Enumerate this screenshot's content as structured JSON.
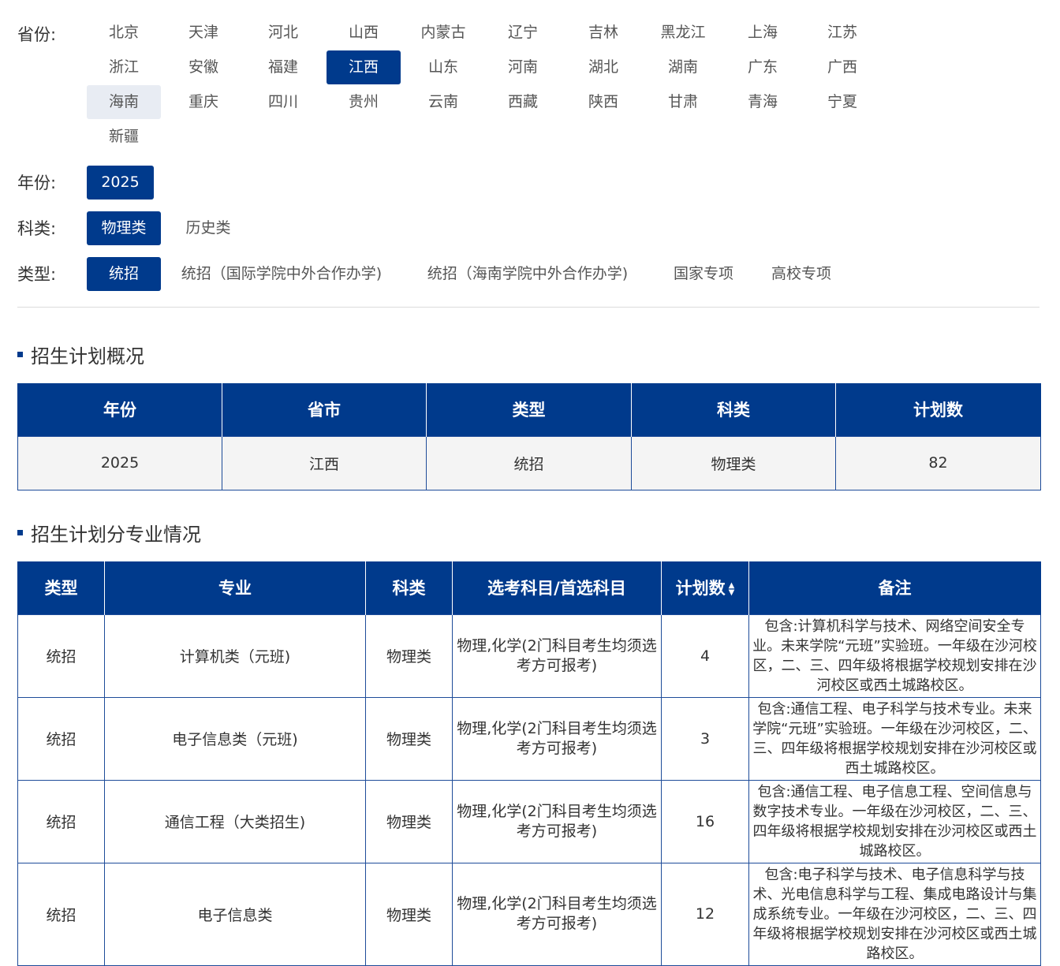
{
  "filters": {
    "province": {
      "label": "省份:",
      "options": [
        "北京",
        "天津",
        "河北",
        "山西",
        "内蒙古",
        "辽宁",
        "吉林",
        "黑龙江",
        "上海",
        "江苏",
        "浙江",
        "安徽",
        "福建",
        "江西",
        "山东",
        "河南",
        "湖北",
        "湖南",
        "广东",
        "广西",
        "海南",
        "重庆",
        "四川",
        "贵州",
        "云南",
        "西藏",
        "陕西",
        "甘肃",
        "青海",
        "宁夏",
        "新疆"
      ],
      "selected": "江西"
    },
    "year": {
      "label": "年份:",
      "options": [
        "2025"
      ],
      "selected": "2025"
    },
    "subject": {
      "label": "科类:",
      "options": [
        "物理类",
        "历史类"
      ],
      "selected": "物理类"
    },
    "type": {
      "label": "类型:",
      "options": [
        "统招",
        "统招（国际学院中外合作办学)",
        "统招（海南学院中外合作办学)",
        "国家专项",
        "高校专项"
      ],
      "selected": "统招"
    }
  },
  "colors": {
    "primary": "#003a8c",
    "hover": "#e8ecf3"
  },
  "summary": {
    "title": "招生计划概况",
    "headers": [
      "年份",
      "省市",
      "类型",
      "科类",
      "计划数"
    ],
    "row": [
      "2025",
      "江西",
      "统招",
      "物理类",
      "82"
    ]
  },
  "majors": {
    "title": "招生计划分专业情况",
    "headers": [
      "类型",
      "专业",
      "科类",
      "选考科目/首选科目",
      "计划数",
      "备注"
    ],
    "sort_icon": "sort-icon",
    "rows": [
      [
        "统招",
        "计算机类（元班)",
        "物理类",
        "物理,化学(2门科目考生均须选考方可报考)",
        "4",
        "包含:计算机科学与技术、网络空间安全专业。未来学院“元班”实验班。一年级在沙河校区，二、三、四年级将根据学校规划安排在沙河校区或西土城路校区。"
      ],
      [
        "统招",
        "电子信息类（元班)",
        "物理类",
        "物理,化学(2门科目考生均须选考方可报考)",
        "3",
        "包含:通信工程、电子科学与技术专业。未来学院“元班”实验班。一年级在沙河校区，二、三、四年级将根据学校规划安排在沙河校区或西土城路校区。"
      ],
      [
        "统招",
        "通信工程（大类招生)",
        "物理类",
        "物理,化学(2门科目考生均须选考方可报考)",
        "16",
        "包含:通信工程、电子信息工程、空间信息与数字技术专业。一年级在沙河校区，二、三、四年级将根据学校规划安排在沙河校区或西土城路校区。"
      ],
      [
        "统招",
        "电子信息类",
        "物理类",
        "物理,化学(2门科目考生均须选考方可报考)",
        "12",
        "包含:电子科学与技术、电子信息科学与技术、光电信息科学与工程、集成电路设计与集成系统专业。一年级在沙河校区，二、三、四年级将根据学校规划安排在沙河校区或西土城路校区。"
      ]
    ]
  }
}
